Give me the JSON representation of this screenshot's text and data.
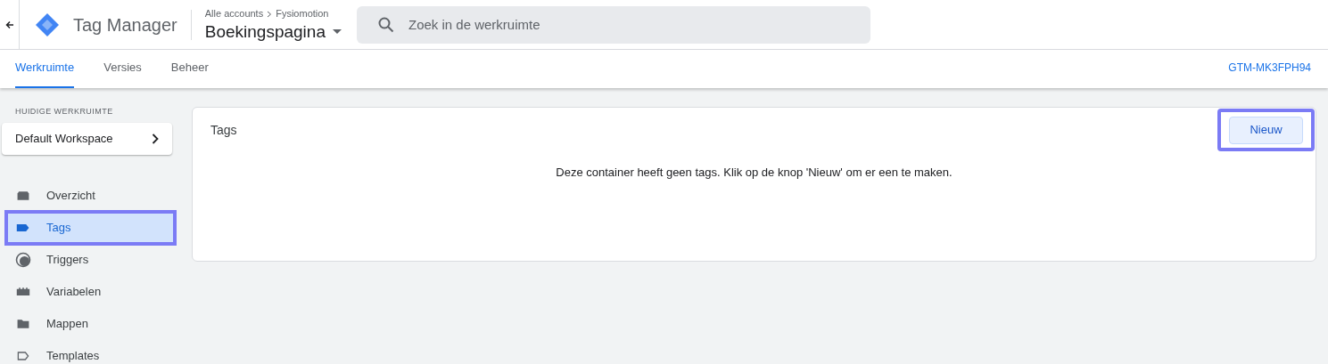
{
  "header": {
    "app_name": "Tag Manager",
    "breadcrumb": [
      "Alle accounts",
      "Fysiomotion"
    ],
    "container": "Boekingspagina",
    "search": {
      "placeholder": "Zoek in de werkruimte"
    }
  },
  "tabs": [
    {
      "label": "Werkruimte",
      "selected": true
    },
    {
      "label": "Versies",
      "selected": false
    },
    {
      "label": "Beheer",
      "selected": false
    }
  ],
  "container_id": "GTM-MK3FPH94",
  "sidebar": {
    "section_label": "HUIDIGE WERKRUIMTE",
    "workspace": "Default Workspace",
    "items": [
      {
        "label": "Overzicht",
        "kind": "overview",
        "selected": false,
        "highlighted": false
      },
      {
        "label": "Tags",
        "kind": "tag",
        "selected": true,
        "highlighted": true
      },
      {
        "label": "Triggers",
        "kind": "trigger",
        "selected": false,
        "highlighted": false
      },
      {
        "label": "Variabelen",
        "kind": "variable",
        "selected": false,
        "highlighted": false
      },
      {
        "label": "Mappen",
        "kind": "folder",
        "selected": false,
        "highlighted": false
      },
      {
        "label": "Templates",
        "kind": "template",
        "selected": false,
        "highlighted": false
      }
    ]
  },
  "card": {
    "title": "Tags",
    "new_button": {
      "label": "Nieuw",
      "highlighted": true
    },
    "empty_message": "Deze container heeft geen tags. Klik op de knop 'Nieuw' om er een te maken."
  }
}
